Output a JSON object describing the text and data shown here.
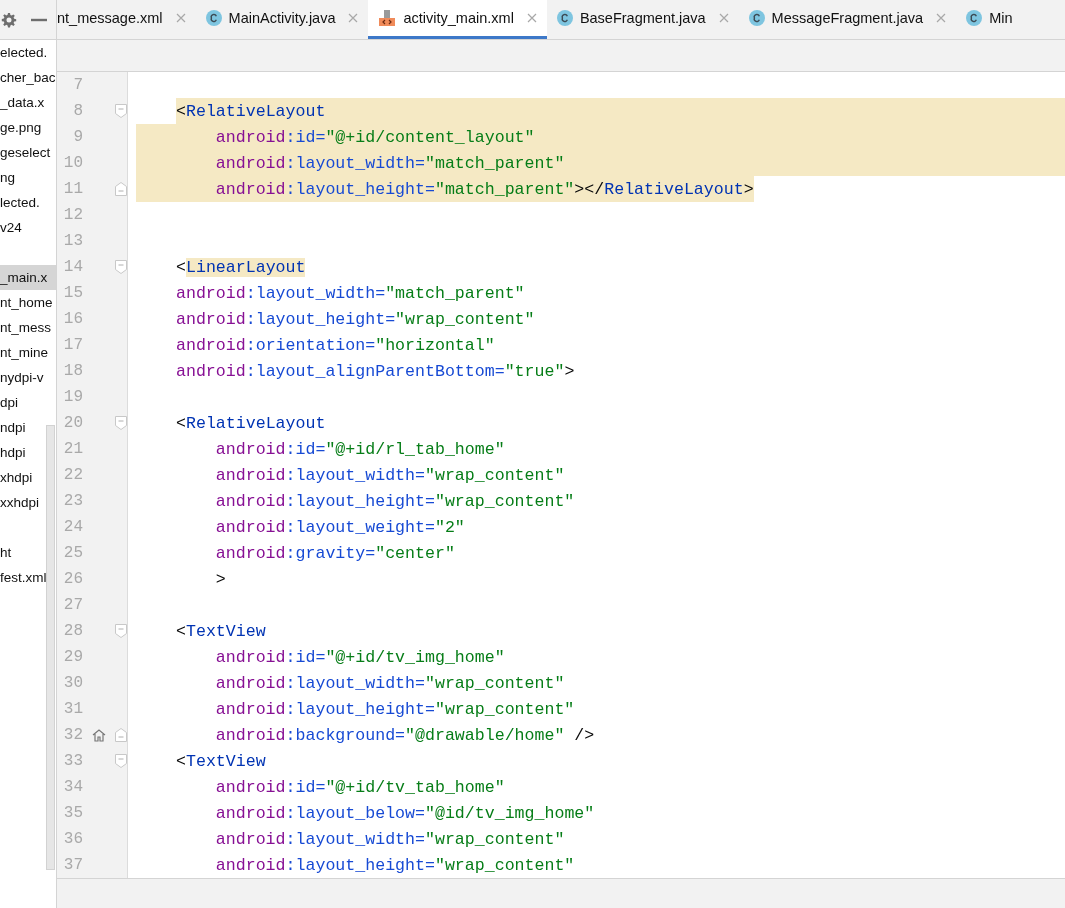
{
  "project_tree": {
    "items": [
      {
        "label": "elected.",
        "selected": false
      },
      {
        "label": "cher_bac",
        "selected": false
      },
      {
        "label": "_data.x",
        "selected": false
      },
      {
        "label": "ge.png",
        "selected": false
      },
      {
        "label": "geselect",
        "selected": false
      },
      {
        "label": "ng",
        "selected": false
      },
      {
        "label": "lected.",
        "selected": false
      },
      {
        "label": "v24",
        "selected": false
      },
      {
        "selected": false
      },
      {
        "label": "_main.x",
        "selected": true
      },
      {
        "label": "nt_home",
        "selected": false
      },
      {
        "label": "nt_mess",
        "selected": false
      },
      {
        "label": "nt_mine",
        "selected": false
      },
      {
        "label": "nydpi-v",
        "selected": false
      },
      {
        "label": "dpi",
        "selected": false
      },
      {
        "label": "ndpi",
        "selected": false
      },
      {
        "label": "hdpi",
        "selected": false
      },
      {
        "label": "xhdpi",
        "selected": false
      },
      {
        "label": "xxhdpi",
        "selected": false
      },
      {
        "selected": false
      },
      {
        "label": "ht",
        "selected": false
      },
      {
        "label": "fest.xml",
        "selected": false
      }
    ]
  },
  "tabs": [
    {
      "label": "nt_message.xml",
      "kind": "none",
      "selected": false,
      "closable": true
    },
    {
      "label": "MainActivity.java",
      "kind": "class",
      "selected": false,
      "closable": true
    },
    {
      "label": "activity_main.xml",
      "kind": "xml",
      "selected": true,
      "closable": true
    },
    {
      "label": "BaseFragment.java",
      "kind": "class",
      "selected": false,
      "closable": true
    },
    {
      "label": "MessageFragment.java",
      "kind": "class",
      "selected": false,
      "closable": true
    },
    {
      "label": "Min",
      "kind": "class",
      "selected": false,
      "closable": false
    }
  ],
  "editor": {
    "lines": [
      {
        "number": "7"
      },
      {
        "number": "8",
        "fold_open": true,
        "highlighted": true,
        "tokens": [
          {
            "kind": "punct",
            "text": "<"
          },
          {
            "kind": "tag",
            "text": "RelativeLayout"
          }
        ]
      },
      {
        "number": "9",
        "highlighted": true,
        "tokens": [
          {
            "kind": "ns",
            "text": "    android"
          },
          {
            "kind": "attr",
            "text": ":id="
          },
          {
            "kind": "value",
            "text": "\"@+id/content_layout\""
          }
        ]
      },
      {
        "number": "10",
        "highlighted": true,
        "tokens": [
          {
            "kind": "ns",
            "text": "    android"
          },
          {
            "kind": "attr",
            "text": ":layout_width="
          },
          {
            "kind": "value",
            "text": "\"match_parent\""
          }
        ]
      },
      {
        "number": "11",
        "fold_close": true,
        "highlighted": true,
        "tokens": [
          {
            "kind": "ns",
            "text": "    android"
          },
          {
            "kind": "attr",
            "text": ":layout_height="
          },
          {
            "kind": "value",
            "text": "\"match_parent\""
          },
          {
            "kind": "punct",
            "text": "></"
          },
          {
            "kind": "tag",
            "text": "RelativeLayout"
          },
          {
            "kind": "punct",
            "text": ">"
          }
        ]
      },
      {
        "number": "12"
      },
      {
        "number": "13"
      },
      {
        "number": "14",
        "fold_open": true,
        "tokens": [
          {
            "kind": "punct",
            "text": "<"
          },
          {
            "kind": "tag-marked",
            "text": "LinearLayout"
          }
        ]
      },
      {
        "number": "15",
        "tokens": [
          {
            "kind": "ns",
            "text": "android"
          },
          {
            "kind": "attr",
            "text": ":layout_width="
          },
          {
            "kind": "value",
            "text": "\"match_parent\""
          }
        ]
      },
      {
        "number": "16",
        "tokens": [
          {
            "kind": "ns",
            "text": "android"
          },
          {
            "kind": "attr",
            "text": ":layout_height="
          },
          {
            "kind": "value",
            "text": "\"wrap_content\""
          }
        ]
      },
      {
        "number": "17",
        "tokens": [
          {
            "kind": "ns",
            "text": "android"
          },
          {
            "kind": "attr",
            "text": ":orientation="
          },
          {
            "kind": "value",
            "text": "\"horizontal\""
          }
        ]
      },
      {
        "number": "18",
        "tokens": [
          {
            "kind": "ns",
            "text": "android"
          },
          {
            "kind": "attr",
            "text": ":layout_alignParentBottom="
          },
          {
            "kind": "value",
            "text": "\"true\""
          },
          {
            "kind": "punct",
            "text": ">"
          }
        ]
      },
      {
        "number": "19"
      },
      {
        "number": "20",
        "fold_open": true,
        "tokens": [
          {
            "kind": "punct",
            "text": "<"
          },
          {
            "kind": "tag",
            "text": "RelativeLayout"
          }
        ]
      },
      {
        "number": "21",
        "tokens": [
          {
            "kind": "ns",
            "text": "    android"
          },
          {
            "kind": "attr",
            "text": ":id="
          },
          {
            "kind": "value",
            "text": "\"@+id/rl_tab_home\""
          }
        ]
      },
      {
        "number": "22",
        "tokens": [
          {
            "kind": "ns",
            "text": "    android"
          },
          {
            "kind": "attr",
            "text": ":layout_width="
          },
          {
            "kind": "value",
            "text": "\"wrap_content\""
          }
        ]
      },
      {
        "number": "23",
        "tokens": [
          {
            "kind": "ns",
            "text": "    android"
          },
          {
            "kind": "attr",
            "text": ":layout_height="
          },
          {
            "kind": "value",
            "text": "\"wrap_content\""
          }
        ]
      },
      {
        "number": "24",
        "tokens": [
          {
            "kind": "ns",
            "text": "    android"
          },
          {
            "kind": "attr",
            "text": ":layout_weight="
          },
          {
            "kind": "value",
            "text": "\"2\""
          }
        ]
      },
      {
        "number": "25",
        "tokens": [
          {
            "kind": "ns",
            "text": "    android"
          },
          {
            "kind": "attr",
            "text": ":gravity="
          },
          {
            "kind": "value",
            "text": "\"center\""
          }
        ]
      },
      {
        "number": "26",
        "tokens": [
          {
            "kind": "punct",
            "text": "    >"
          }
        ]
      },
      {
        "number": "27"
      },
      {
        "number": "28",
        "fold_open": true,
        "tokens": [
          {
            "kind": "punct",
            "text": "<"
          },
          {
            "kind": "tag",
            "text": "TextView"
          }
        ]
      },
      {
        "number": "29",
        "tokens": [
          {
            "kind": "ns",
            "text": "    android"
          },
          {
            "kind": "attr",
            "text": ":id="
          },
          {
            "kind": "value",
            "text": "\"@+id/tv_img_home\""
          }
        ]
      },
      {
        "number": "30",
        "tokens": [
          {
            "kind": "ns",
            "text": "    android"
          },
          {
            "kind": "attr",
            "text": ":layout_width="
          },
          {
            "kind": "value",
            "text": "\"wrap_content\""
          }
        ]
      },
      {
        "number": "31",
        "tokens": [
          {
            "kind": "ns",
            "text": "    android"
          },
          {
            "kind": "attr",
            "text": ":layout_height="
          },
          {
            "kind": "value",
            "text": "\"wrap_content\""
          }
        ]
      },
      {
        "number": "32",
        "fold_close": true,
        "gutter_icon": true,
        "tokens": [
          {
            "kind": "ns",
            "text": "    android"
          },
          {
            "kind": "attr",
            "text": ":background="
          },
          {
            "kind": "value",
            "text": "\"@drawable/home\""
          },
          {
            "kind": "punct",
            "text": " />"
          }
        ]
      },
      {
        "number": "33",
        "fold_open": true,
        "tokens": [
          {
            "kind": "punct",
            "text": "<"
          },
          {
            "kind": "tag",
            "text": "TextView"
          }
        ]
      },
      {
        "number": "34",
        "tokens": [
          {
            "kind": "ns",
            "text": "    android"
          },
          {
            "kind": "attr",
            "text": ":id="
          },
          {
            "kind": "value",
            "text": "\"@+id/tv_tab_home\""
          }
        ]
      },
      {
        "number": "35",
        "tokens": [
          {
            "kind": "ns",
            "text": "    android"
          },
          {
            "kind": "attr",
            "text": ":layout_below="
          },
          {
            "kind": "value",
            "text": "\"@id/tv_img_home\""
          }
        ]
      },
      {
        "number": "36",
        "tokens": [
          {
            "kind": "ns",
            "text": "    android"
          },
          {
            "kind": "attr",
            "text": ":layout_width="
          },
          {
            "kind": "value",
            "text": "\"wrap_content\""
          }
        ]
      },
      {
        "number": "37",
        "tokens": [
          {
            "kind": "ns",
            "text": "    android"
          },
          {
            "kind": "attr",
            "text": ":layout_height="
          },
          {
            "kind": "value",
            "text": "\"wrap_content\""
          }
        ]
      }
    ]
  }
}
